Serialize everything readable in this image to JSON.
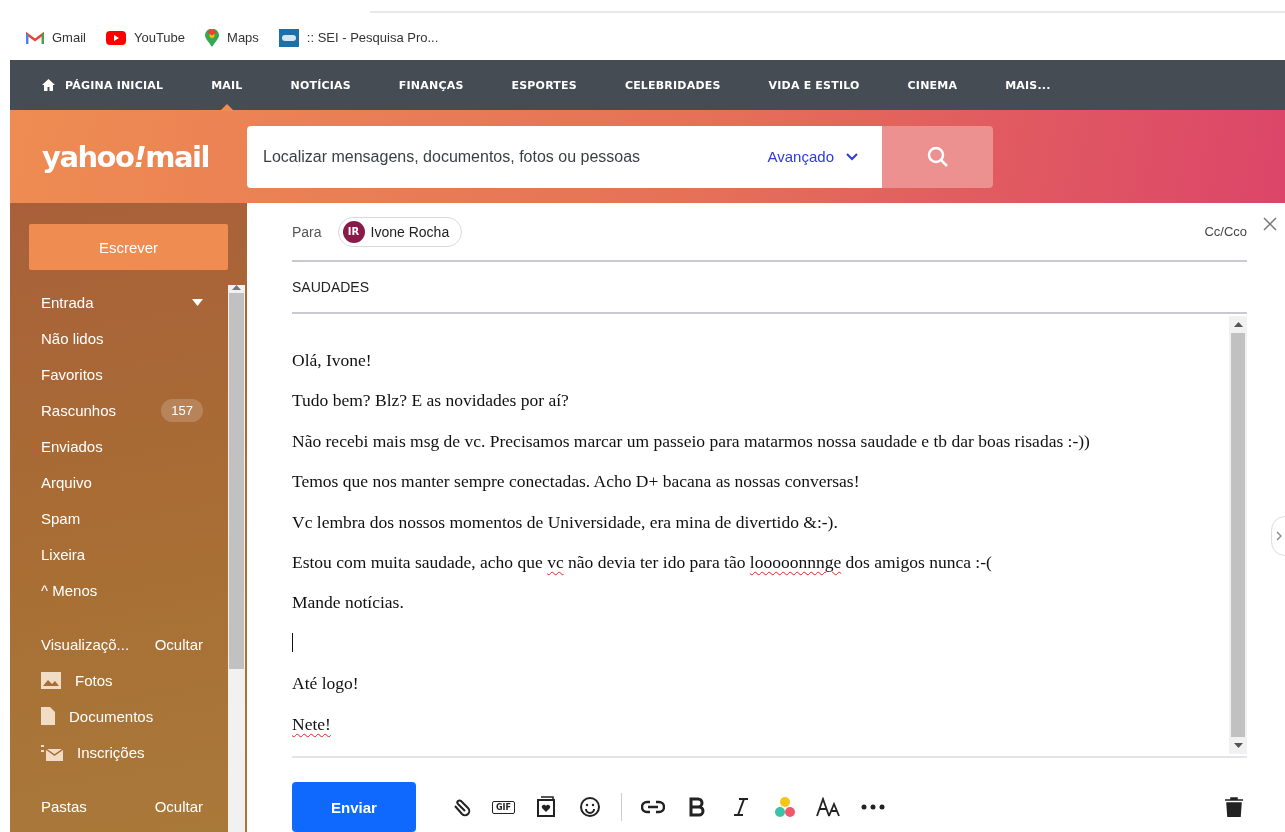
{
  "bookmarks": [
    {
      "kind": "gmail",
      "label": "Gmail"
    },
    {
      "kind": "youtube",
      "label": "YouTube"
    },
    {
      "kind": "maps",
      "label": "Maps"
    },
    {
      "kind": "sei",
      "label": ":: SEI - Pesquisa Pro..."
    }
  ],
  "nav": [
    {
      "label": "PÁGINA INICIAL",
      "home": true,
      "selected": false
    },
    {
      "label": "MAIL",
      "home": false,
      "selected": true
    },
    {
      "label": "NOTÍCIAS",
      "home": false,
      "selected": false
    },
    {
      "label": "FINANÇAS",
      "home": false,
      "selected": false
    },
    {
      "label": "ESPORTES",
      "home": false,
      "selected": false
    },
    {
      "label": "CELEBRIDADES",
      "home": false,
      "selected": false
    },
    {
      "label": "VIDA E ESTILO",
      "home": false,
      "selected": false
    },
    {
      "label": "CINEMA",
      "home": false,
      "selected": false
    },
    {
      "label": "MAIS...",
      "home": false,
      "selected": false
    }
  ],
  "logo": {
    "left": "yahoo",
    "mark": "!",
    "right": "mail"
  },
  "search": {
    "placeholder": "Localizar mensagens, documentos, fotos ou pessoas",
    "advanced": "Avançado"
  },
  "compose_button": "Escrever",
  "folders": [
    {
      "label": "Entrada",
      "caret": true
    },
    {
      "label": "Não lidos",
      "caret": false
    },
    {
      "label": "Favoritos",
      "caret": false
    },
    {
      "label": "Rascunhos",
      "caret": false,
      "count": "157"
    },
    {
      "label": "Enviados",
      "caret": false
    },
    {
      "label": "Arquivo",
      "caret": false
    },
    {
      "label": "Spam",
      "caret": false
    },
    {
      "label": "Lixeira",
      "caret": false
    }
  ],
  "less_toggle": {
    "icon": "^",
    "label": "Menos"
  },
  "views": {
    "title": "Visualizaçõ...",
    "action": "Ocultar",
    "items": [
      {
        "kind": "photos",
        "label": "Fotos"
      },
      {
        "kind": "documents",
        "label": "Documentos"
      },
      {
        "kind": "subscriptions",
        "label": "Inscrições"
      }
    ]
  },
  "folders_section": {
    "title": "Pastas",
    "action": "Ocultar"
  },
  "compose": {
    "to_label": "Para",
    "recipient": {
      "initials": "IR",
      "name": "Ivone Rocha"
    },
    "cc": "Cc/Cco",
    "subject": "SAUDADES",
    "body": [
      {
        "kind": "text",
        "segments": [
          {
            "text": "Olá, Ivone!",
            "misspelled": false
          }
        ]
      },
      {
        "kind": "text",
        "segments": [
          {
            "text": "Tudo bem? Blz? E as novidades por aí?",
            "misspelled": false
          }
        ]
      },
      {
        "kind": "text",
        "segments": [
          {
            "text": "Não recebi mais msg de vc. Precisamos marcar um passeio para matarmos nossa saudade e tb dar boas risadas :-))",
            "misspelled": false
          }
        ]
      },
      {
        "kind": "text",
        "segments": [
          {
            "text": "Temos que nos manter sempre conectadas. Acho D+ bacana as nossas conversas!",
            "misspelled": false
          }
        ]
      },
      {
        "kind": "text",
        "segments": [
          {
            "text": "Vc lembra dos nossos momentos de Universidade, era mina de divertido &:-).",
            "misspelled": false
          }
        ]
      },
      {
        "kind": "text",
        "segments": [
          {
            "text": "Estou com muita saudade, acho que ",
            "misspelled": false
          },
          {
            "text": "vc",
            "misspelled": true
          },
          {
            "text": " não devia ter ido para tão ",
            "misspelled": false
          },
          {
            "text": "looooonnnge",
            "misspelled": true
          },
          {
            "text": " dos amigos nunca :-(",
            "misspelled": false
          }
        ]
      },
      {
        "kind": "text",
        "segments": [
          {
            "text": "Mande notícias.",
            "misspelled": false
          }
        ]
      },
      {
        "kind": "cursor"
      },
      {
        "kind": "text",
        "segments": [
          {
            "text": "Até logo!",
            "misspelled": false
          }
        ]
      },
      {
        "kind": "text",
        "segments": [
          {
            "text": "Nete!",
            "misspelled": true
          }
        ]
      }
    ],
    "send": "Enviar",
    "tools": [
      {
        "kind": "attach"
      },
      {
        "kind": "gif",
        "label": "GIF"
      },
      {
        "kind": "sticker"
      },
      {
        "kind": "emoji"
      },
      {
        "kind": "separator"
      },
      {
        "kind": "link"
      },
      {
        "kind": "bold"
      },
      {
        "kind": "italic"
      },
      {
        "kind": "colors"
      },
      {
        "kind": "size"
      },
      {
        "kind": "more"
      }
    ]
  }
}
